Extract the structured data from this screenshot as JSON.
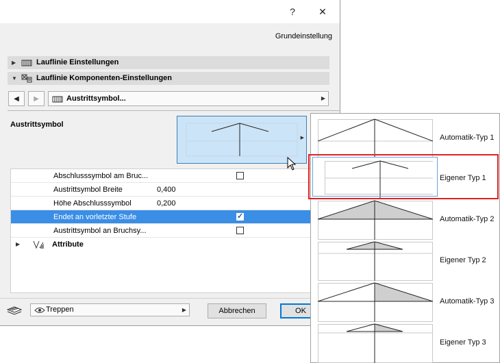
{
  "titlebar": {
    "help_label": "?",
    "close_label": "✕"
  },
  "header": {
    "preset_label": "Grundeinstellung"
  },
  "sections": [
    {
      "label": "Lauflinie Einstellungen",
      "expanded": false
    },
    {
      "label": "Lauflinie Komponenten-Einstellungen",
      "expanded": true
    }
  ],
  "nav": {
    "component_label": "Austrittsymbol..."
  },
  "symbol": {
    "label": "Austrittsymbol"
  },
  "table": {
    "rows": [
      {
        "label": "Abschlusssymbol am Bruc...",
        "value": "",
        "checked": false,
        "has_check": true
      },
      {
        "label": "Austrittsymbol Breite",
        "value": "0,400",
        "has_check": false
      },
      {
        "label": "Höhe Abschlusssymbol",
        "value": "0,200",
        "has_check": false
      },
      {
        "label": "Endet an vorletzter Stufe",
        "value": "",
        "checked": true,
        "has_check": true
      },
      {
        "label": "Austrittsymbol an Bruchsy...",
        "value": "",
        "checked": false,
        "has_check": true
      }
    ],
    "attribute_label": "Attribute"
  },
  "footer": {
    "layer_value": "Treppen",
    "cancel_label": "Abbrechen",
    "ok_label": "OK"
  },
  "popup": {
    "items": [
      {
        "label": "Automatik-Typ 1"
      },
      {
        "label": "Eigener Typ 1"
      },
      {
        "label": "Automatik-Typ 2"
      },
      {
        "label": "Eigener Typ 2"
      },
      {
        "label": "Automatik-Typ 3"
      },
      {
        "label": "Eigener Typ 3"
      }
    ]
  },
  "colors": {
    "selection": "#3a8ee6",
    "preview_bg": "#cce4f7",
    "highlight_border": "#e02020"
  }
}
